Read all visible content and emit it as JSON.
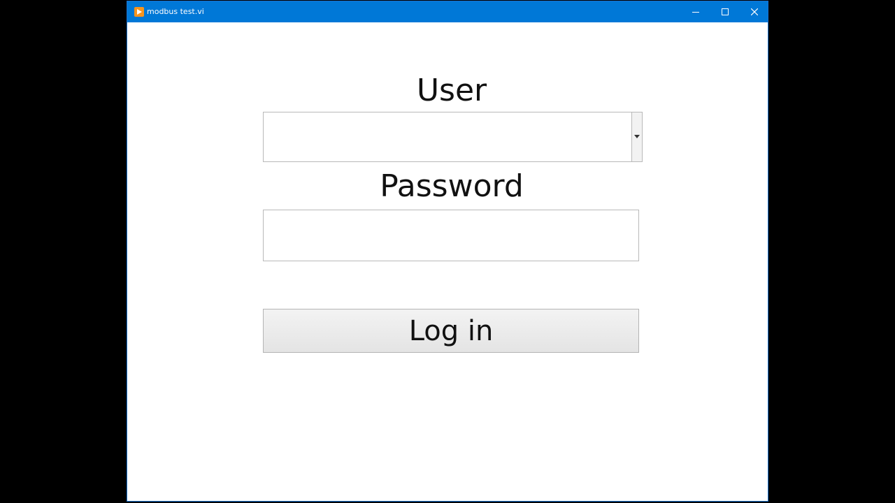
{
  "window": {
    "title": "modbus test.vi",
    "icon": "labview-run-icon",
    "controls": [
      "minimize-icon",
      "maximize-icon",
      "close-icon"
    ]
  },
  "form": {
    "user_label": "User",
    "user_value": "",
    "password_label": "Password",
    "password_value": "",
    "login_label": "Log in"
  },
  "colors": {
    "titlebar": "#0078d7",
    "app_icon": "#f7941d",
    "background": "#ffffff",
    "border": "#b9b9b9",
    "button_face": "#e9e9e9"
  }
}
